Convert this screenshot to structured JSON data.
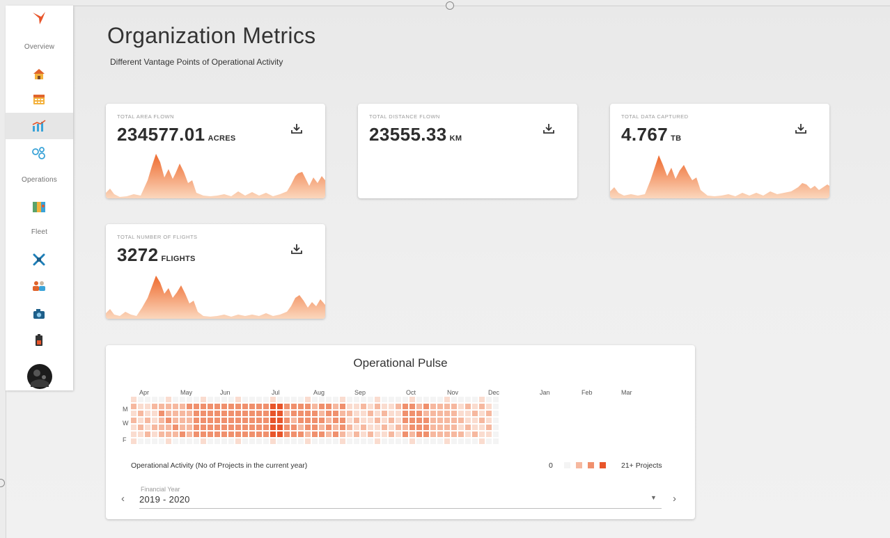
{
  "header": {
    "title": "Organization Metrics",
    "subtitle": "Different Vantage Points of Operational Activity"
  },
  "sidebar": {
    "sections": [
      "Overview",
      "Operations",
      "Fleet"
    ],
    "icons": [
      "logo-bird-icon",
      "home-icon",
      "calendar-icon",
      "analytics-icon",
      "operations-network-icon",
      "map-icon",
      "drone-icon",
      "pilots-icon",
      "camera-icon",
      "battery-icon",
      "user-avatar"
    ],
    "active": "analytics-icon",
    "accent": "#e8552a"
  },
  "cards": [
    {
      "label": "TOTAL AREA FLOWN",
      "value": "234577.01",
      "unit": "ACRES",
      "has_chart": true
    },
    {
      "label": "TOTAL DISTANCE FLOWN",
      "value": "23555.33",
      "unit": "KM",
      "has_chart": false
    },
    {
      "label": "TOTAL DATA CAPTURED",
      "value": "4.767",
      "unit": "TB",
      "has_chart": true
    },
    {
      "label": "TOTAL NUMBER OF FLIGHTS",
      "value": "3272",
      "unit": "FLIGHTS",
      "has_chart": true
    }
  ],
  "pulse": {
    "title": "Operational Pulse",
    "months": [
      "Apr",
      "May",
      "Jun",
      "Jul",
      "Aug",
      "Sep",
      "Oct",
      "Nov",
      "Dec",
      "Jan",
      "Feb",
      "Mar"
    ],
    "days": [
      "M",
      "W",
      "F"
    ],
    "caption": "Operational Activity (No of Projects in the current year)",
    "legend_min": "0",
    "legend_max": "21+ Projects",
    "levels": [
      "#f4f4f4",
      "#fadccf",
      "#f6b89f",
      "#f0906d",
      "#e8552a"
    ],
    "financial_year_label": "Financial Year",
    "financial_year_value": "2019 - 2020",
    "prev_symbol": "‹",
    "next_symbol": "›"
  },
  "colors": {
    "accent": "#e8552a",
    "chart_fill_top": "#ee6a2e",
    "chart_fill_bottom": "#fbd7bd"
  }
}
